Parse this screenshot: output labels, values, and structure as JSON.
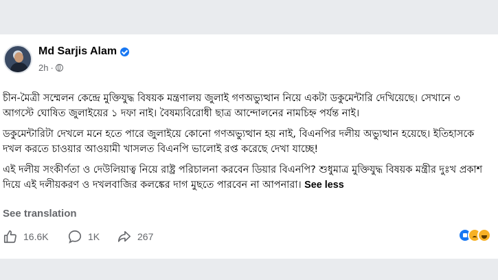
{
  "post": {
    "author_name": "Md Sarjis Alam",
    "timestamp": "2h",
    "separator": "·",
    "paragraphs": [
      "চীন-মৈত্রী সম্মেলন কেন্দ্রে মুক্তিযুদ্ধ বিষয়ক মন্ত্রণালয় জুলাই গণঅভ্যুত্থান নিয়ে একটা ডকুমেন্টারি দেখিয়েছে। সেখানে ৩ আগস্টে ঘোষিত জুলাইয়ের ১ দফা নাই। বৈষম্যবিরোধী ছাত্র আন্দোলনের নামচিহ্ন পর্যন্ত নাই।",
      "ডকুমেন্টারিটা দেখলে মনে হতে পারে জুলাইয়ে কোনো গণঅভ্যুত্থান হয় নাই, বিএনপির দলীয় অভ্যুত্থান হয়েছে। ইতিহাসকে দখল করতে চাওয়ার আওয়ামী খাসলত বিএনপি ভালোই রপ্ত করেছে দেখা যাচ্ছে!",
      "এই দলীয় সংকীর্ণতা ও দেউলিয়াত্ব নিয়ে রাষ্ট্র পরিচালনা করবেন ডিয়ার বিএনপি? শুধুমাত্র মুক্তিযুদ্ধ বিষয়ক মন্ত্রীর দুঃখ প্রকাশ দিয়ে এই দলীয়করণ ও দখলবাজির কলঙ্কের দাগ মুছতে পারবেন না আপনারা।"
    ],
    "see_less": "See less",
    "see_translation": "See translation"
  },
  "actions": {
    "likes": "16.6K",
    "comments": "1K",
    "shares": "267"
  },
  "icons": {
    "verified": "verified-badge-icon",
    "audience": "globe-icon",
    "like": "thumbs-up-icon",
    "comment": "comment-bubble-icon",
    "share": "share-arrow-icon",
    "reactions": [
      "like-reaction-icon",
      "sad-reaction-icon",
      "haha-reaction-icon"
    ]
  },
  "colors": {
    "verified": "#1877f2",
    "secondary_text": "#65676b",
    "primary_text": "#050505"
  }
}
